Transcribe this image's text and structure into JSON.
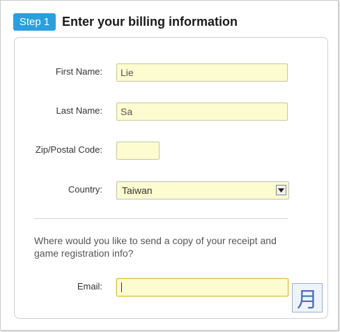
{
  "header": {
    "step_label": "Step 1",
    "title": "Enter your billing information"
  },
  "form": {
    "first_name": {
      "label": "First Name:",
      "value": "Lie"
    },
    "last_name": {
      "label": "Last Name:",
      "value": "Sa"
    },
    "zip": {
      "label": "Zip/Postal Code:",
      "value": ""
    },
    "country": {
      "label": "Country:",
      "value": "Taiwan"
    },
    "question": "Where would you like to send a copy of your receipt and game registration info?",
    "email": {
      "label": "Email:",
      "value": ""
    }
  },
  "ime": {
    "glyph": "月",
    "icon": "ime-indicator-icon"
  },
  "colors": {
    "step_badge": "#2b9fde",
    "input_bg": "#fdfcd0",
    "focus_border": "#e0b84a"
  }
}
